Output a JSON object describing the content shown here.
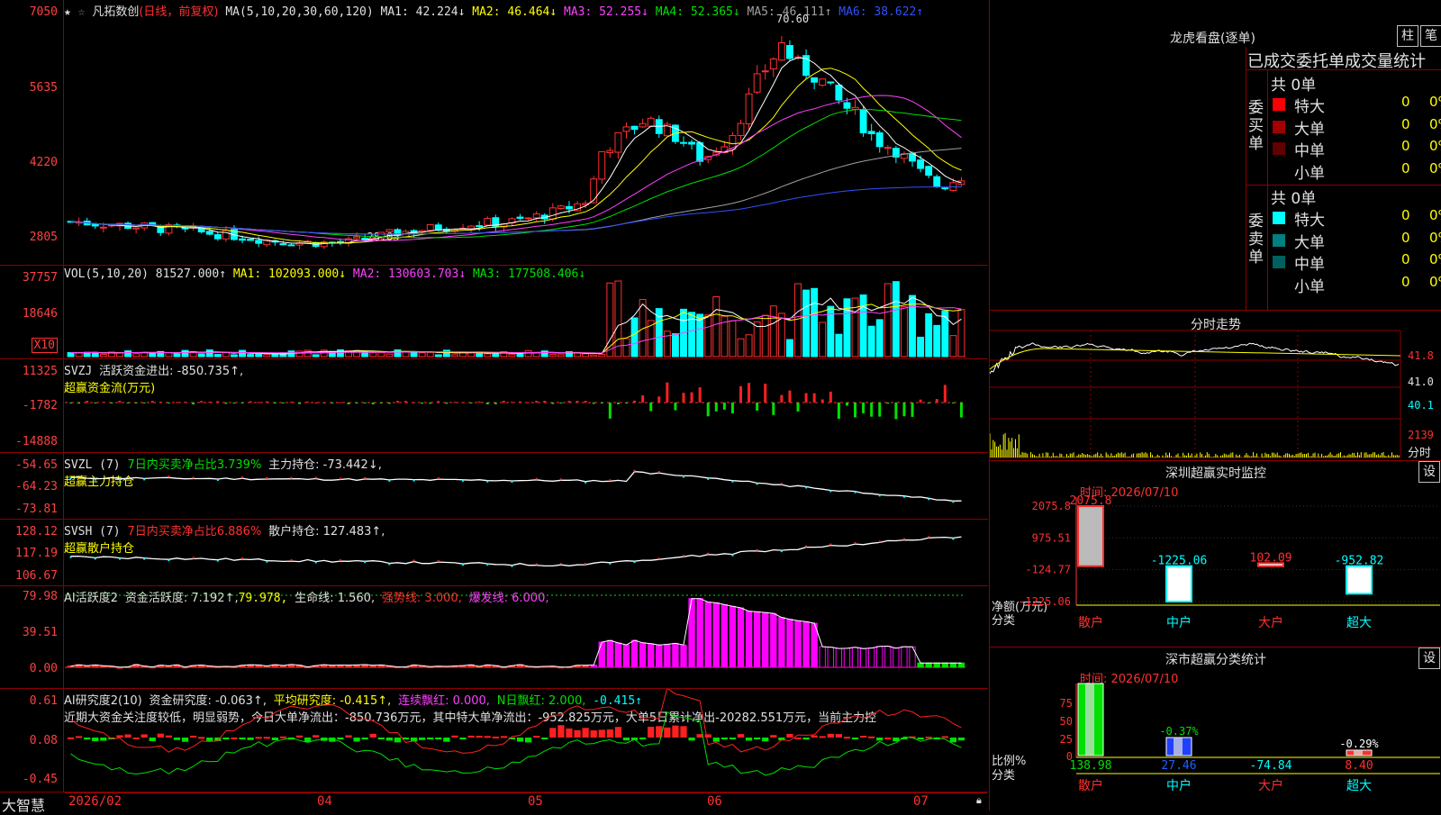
{
  "main": {
    "title": "凡拓数创",
    "subtitle": "(日线，前复权)",
    "ma_label": "MA(5,10,20,30,60,120)",
    "ma1": "MA1: 42.224↓",
    "ma2": "MA2: 46.464↓",
    "ma3": "MA3: 52.255↓",
    "ma4": "MA4: 52.365↓",
    "ma5": "MA5: 46.111↑",
    "ma6": "MA6: 38.622↑",
    "yticks": [
      "7050",
      "5635",
      "4220",
      "2805"
    ],
    "high_mark": "70.60",
    "low_mark": "← 28.05"
  },
  "volume": {
    "label": "VOL(5,10,20)",
    "value": "81527.000↑",
    "ma1": "MA1: 102093.000↓",
    "ma2": "MA2: 130603.703↓",
    "ma3": "MA3: 177508.406↓",
    "yticks": [
      "37757",
      "18646"
    ],
    "unit": "X10"
  },
  "svzj": {
    "label": "SVZJ",
    "text": "活跃资金进出: -850.735↑,",
    "name": "超赢资金流(万元)",
    "yticks": [
      "11325",
      "-1782",
      "-14888"
    ]
  },
  "svzl": {
    "label": "SVZL (7)",
    "ratio": "7日内买卖净占比3.739%",
    "hold": "主力持仓: -73.442↓,",
    "name": "超赢主力持仓",
    "yticks": [
      "-54.65",
      "-64.23",
      "-73.81"
    ]
  },
  "svsh": {
    "label": "SVSH (7)",
    "ratio": "7日内买卖净占比6.886%",
    "hold": "散户持仓: 127.483↑,",
    "name": "超赢散户持仓",
    "yticks": [
      "128.12",
      "117.19",
      "106.67"
    ]
  },
  "ai_active": {
    "label": "AI活跃度2",
    "t1": "资金活跃度: 7.192↑,",
    "t2": "79.978,",
    "t3": "生命线: 1.560,",
    "t4": "强势线: 3.000,",
    "t5": "爆发线: 6.000,",
    "yticks": [
      "79.98",
      "39.51",
      "0.00"
    ]
  },
  "ai_research": {
    "label": "AI研究度2(10)",
    "t1": "资金研究度: -0.063↑,",
    "t2": "平均研究度: -0.415↑,",
    "t3": "连续飘红: 0.000,",
    "t4": "N日飘红: 2.000,",
    "t5": "-0.415↑",
    "comment": "近期大资金关注度较低，明显弱势，今日大单净流出：-850.736万元，其中特大单净流出：-952.825万元，大单5日累计净出-20282.551万元，当前主力控",
    "yticks": [
      "0.61",
      "0.08",
      "-0.45"
    ]
  },
  "xaxis": {
    "labels": [
      "2026/02",
      "04",
      "05",
      "06",
      "07"
    ],
    "brand": "大智慧"
  },
  "longhu": {
    "title": "龙虎看盘(逐单)",
    "btn1": "柱",
    "btn2": "笔",
    "header": "已成交委托单成交量统计",
    "buy": {
      "side": "委买单",
      "total": "共 0单",
      "rows": [
        {
          "label": "特大",
          "val": "0",
          "pct": "0%",
          "color": "#ff0000"
        },
        {
          "label": "大单",
          "val": "0",
          "pct": "0%",
          "color": "#a00000"
        },
        {
          "label": "中单",
          "val": "0",
          "pct": "0%",
          "color": "#600000"
        },
        {
          "label": "小单",
          "val": "0",
          "pct": "0%",
          "color": "#000000"
        }
      ]
    },
    "sell": {
      "side": "委卖单",
      "total": "共 0单",
      "rows": [
        {
          "label": "特大",
          "val": "0",
          "pct": "0%",
          "color": "#00ffff"
        },
        {
          "label": "大单",
          "val": "0",
          "pct": "0%",
          "color": "#008080"
        },
        {
          "label": "中单",
          "val": "0",
          "pct": "0%",
          "color": "#006060"
        },
        {
          "label": "小单",
          "val": "0",
          "pct": "0%",
          "color": "#000000"
        }
      ]
    }
  },
  "intraday": {
    "title": "分时走势",
    "yticks": [
      "41.8",
      "41.0",
      "40.1"
    ],
    "vol_tick": "2139",
    "vol_label": "分时"
  },
  "monitor": {
    "title": "深圳超赢实时监控",
    "btn": "设",
    "time": "时间: 2026/07/10",
    "yticks": [
      "2075.8",
      "975.51",
      "-124.77",
      "-1225.06"
    ],
    "ylabel1": "净额(万元)",
    "ylabel2": "分类",
    "cats": [
      "散户",
      "中户",
      "大户",
      "超大"
    ],
    "values": [
      "2075.8",
      "-1225.06",
      "102.09",
      "-952.82"
    ],
    "nums": [
      2075.8,
      -1225.06,
      102.09,
      -952.82
    ]
  },
  "classify": {
    "title": "深市超赢分类统计",
    "btn": "设",
    "time": "时间: 2026/07/10",
    "yticks": [
      "75",
      "50",
      "25",
      "0"
    ],
    "ylabel1": "比例%",
    "ylabel2": "分类",
    "cats": [
      "散户",
      "中户",
      "大户",
      "超大"
    ],
    "top_labels": [
      "",
      "-0.37%",
      "",
      "-0.29%"
    ],
    "values": [
      "138.98",
      "27.46",
      "-74.84",
      "8.40"
    ]
  }
}
